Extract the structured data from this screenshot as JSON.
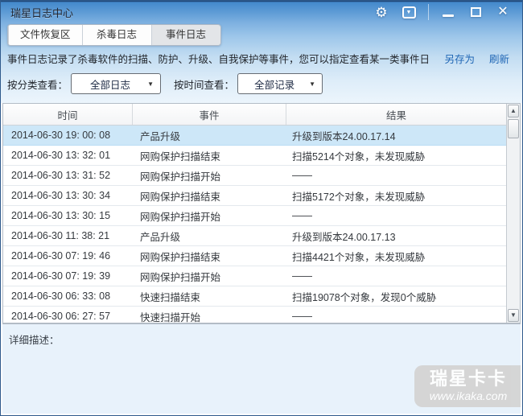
{
  "window": {
    "title": "瑞星日志中心"
  },
  "titlebar": {
    "close_glyph": "✕",
    "gear_glyph": "⚙",
    "box_arrow_glyph": "▼"
  },
  "tabs": [
    {
      "label": "文件恢复区",
      "active": false
    },
    {
      "label": "杀毒日志",
      "active": false
    },
    {
      "label": "事件日志",
      "active": true
    }
  ],
  "description": {
    "text": "事件日志记录了杀毒软件的扫描、防护、升级、自我保护等事件，您可以指定查看某一类事件日志。",
    "save_as": "另存为",
    "refresh": "刷新"
  },
  "filters": {
    "category_label": "按分类查看：",
    "category_value": "全部日志",
    "time_label": "按时间查看：",
    "time_value": "全部记录",
    "arrow_glyph": "▼"
  },
  "table": {
    "columns": [
      "时间",
      "事件",
      "结果"
    ],
    "rows": [
      {
        "time": "2014-06-30 19: 00: 08",
        "event": "产品升级",
        "result": "升级到版本24.00.17.14",
        "selected": true
      },
      {
        "time": "2014-06-30 13: 32: 01",
        "event": "网购保护扫描结束",
        "result": "扫描5214个对象，未发现威胁",
        "selected": false
      },
      {
        "time": "2014-06-30 13: 31: 52",
        "event": "网购保护扫描开始",
        "result": "——",
        "selected": false
      },
      {
        "time": "2014-06-30 13: 30: 34",
        "event": "网购保护扫描结束",
        "result": "扫描5172个对象，未发现威胁",
        "selected": false
      },
      {
        "time": "2014-06-30 13: 30: 15",
        "event": "网购保护扫描开始",
        "result": "——",
        "selected": false
      },
      {
        "time": "2014-06-30 11: 38: 21",
        "event": "产品升级",
        "result": "升级到版本24.00.17.13",
        "selected": false
      },
      {
        "time": "2014-06-30 07: 19: 46",
        "event": "网购保护扫描结束",
        "result": "扫描4421个对象，未发现威胁",
        "selected": false
      },
      {
        "time": "2014-06-30 07: 19: 39",
        "event": "网购保护扫描开始",
        "result": "——",
        "selected": false
      },
      {
        "time": "2014-06-30 06: 33: 08",
        "event": "快速扫描结束",
        "result": "扫描19078个对象，发现0个威胁",
        "selected": false
      },
      {
        "time": "2014-06-30 06: 27: 57",
        "event": "快速扫描开始",
        "result": "——",
        "selected": false
      }
    ]
  },
  "scrollbar": {
    "up_glyph": "▲",
    "down_glyph": "▼"
  },
  "detail": {
    "label": "详细描述："
  },
  "watermark": {
    "brand": "瑞星卡卡",
    "url": "www.ikaka.com"
  },
  "colors": {
    "titlebar_blue": "#4489cc",
    "selected_row": "#cde7f8",
    "link_blue": "#1f66b5",
    "detail_bg": "#e8f2fb"
  }
}
